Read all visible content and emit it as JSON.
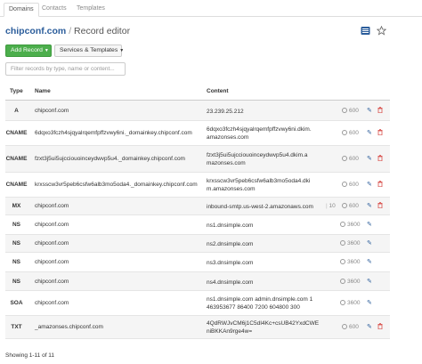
{
  "tabs": [
    {
      "label": "Domains",
      "active": true
    },
    {
      "label": "Contacts",
      "active": false
    },
    {
      "label": "Templates",
      "active": false
    }
  ],
  "header": {
    "domain": "chipconf.com",
    "separator": "/",
    "subtitle": "Record editor",
    "icons": [
      "list-icon",
      "star-icon"
    ]
  },
  "toolbar": {
    "add_record_label": "Add Record",
    "services_label": "Services & Templates"
  },
  "filter": {
    "placeholder": "Filter records by type, name or content...",
    "value": ""
  },
  "table": {
    "columns": [
      "Type",
      "Name",
      "Content"
    ],
    "rows": [
      {
        "type": "A",
        "name": "chipconf.com",
        "content": [
          "23.239.25.212"
        ],
        "priority": "",
        "ttl": "600",
        "editable": true
      },
      {
        "type": "CNAME",
        "name": "6dqxo3fczh4sjqyalrqemfpffzvwy6ni._domainkey.chipconf.com",
        "content": [
          "6dqxo3fczh4sjqyalrqemfpffzvwy6ni.dkim.",
          "amazonses.com"
        ],
        "priority": "",
        "ttl": "600",
        "editable": true
      },
      {
        "type": "CNAME",
        "name": "fzxt3j5ui5ujcciouoinceydwvp5u4._domainkey.chipconf.com",
        "content": [
          "fzxt3j5ui5ujcciouoinceydwvp5u4.dkim.a",
          "mazonses.com"
        ],
        "priority": "",
        "ttl": "600",
        "editable": true
      },
      {
        "type": "CNAME",
        "name": "krxsscw3vr5peb6csfw6alb3mo5oda4._domainkey.chipconf.com",
        "content": [
          "krxsscw3vr5peb6csfw6alb3mo5oda4.dki",
          "m.amazonses.com"
        ],
        "priority": "",
        "ttl": "600",
        "editable": true
      },
      {
        "type": "MX",
        "name": "chipconf.com",
        "content": [
          "inbound-smtp.us-west-2.amazonaws.com"
        ],
        "priority": "10",
        "ttl": "600",
        "editable": true
      },
      {
        "type": "NS",
        "name": "chipconf.com",
        "content": [
          "ns1.dnsimple.com"
        ],
        "priority": "",
        "ttl": "3600",
        "editable": false
      },
      {
        "type": "NS",
        "name": "chipconf.com",
        "content": [
          "ns2.dnsimple.com"
        ],
        "priority": "",
        "ttl": "3600",
        "editable": false
      },
      {
        "type": "NS",
        "name": "chipconf.com",
        "content": [
          "ns3.dnsimple.com"
        ],
        "priority": "",
        "ttl": "3600",
        "editable": false
      },
      {
        "type": "NS",
        "name": "chipconf.com",
        "content": [
          "ns4.dnsimple.com"
        ],
        "priority": "",
        "ttl": "3600",
        "editable": false
      },
      {
        "type": "SOA",
        "name": "chipconf.com",
        "content": [
          "ns1.dnsimple.com admin.dnsimple.com 1",
          "463953677 86400 7200 604800 300"
        ],
        "priority": "",
        "ttl": "3600",
        "editable": false
      },
      {
        "type": "TXT",
        "name": "_amazonses.chipconf.com",
        "content": [
          "4QdRWJvCM6j1C5dI4Kc+csUB42YxdCWE",
          "niBKKAn9rge4w="
        ],
        "priority": "",
        "ttl": "600",
        "editable": true
      }
    ]
  },
  "footer": {
    "summary": "Showing 1-11 of 11"
  },
  "colors": {
    "accent": "#2b5d9b",
    "add_button": "#4cae4c",
    "delete": "#d9534f"
  }
}
